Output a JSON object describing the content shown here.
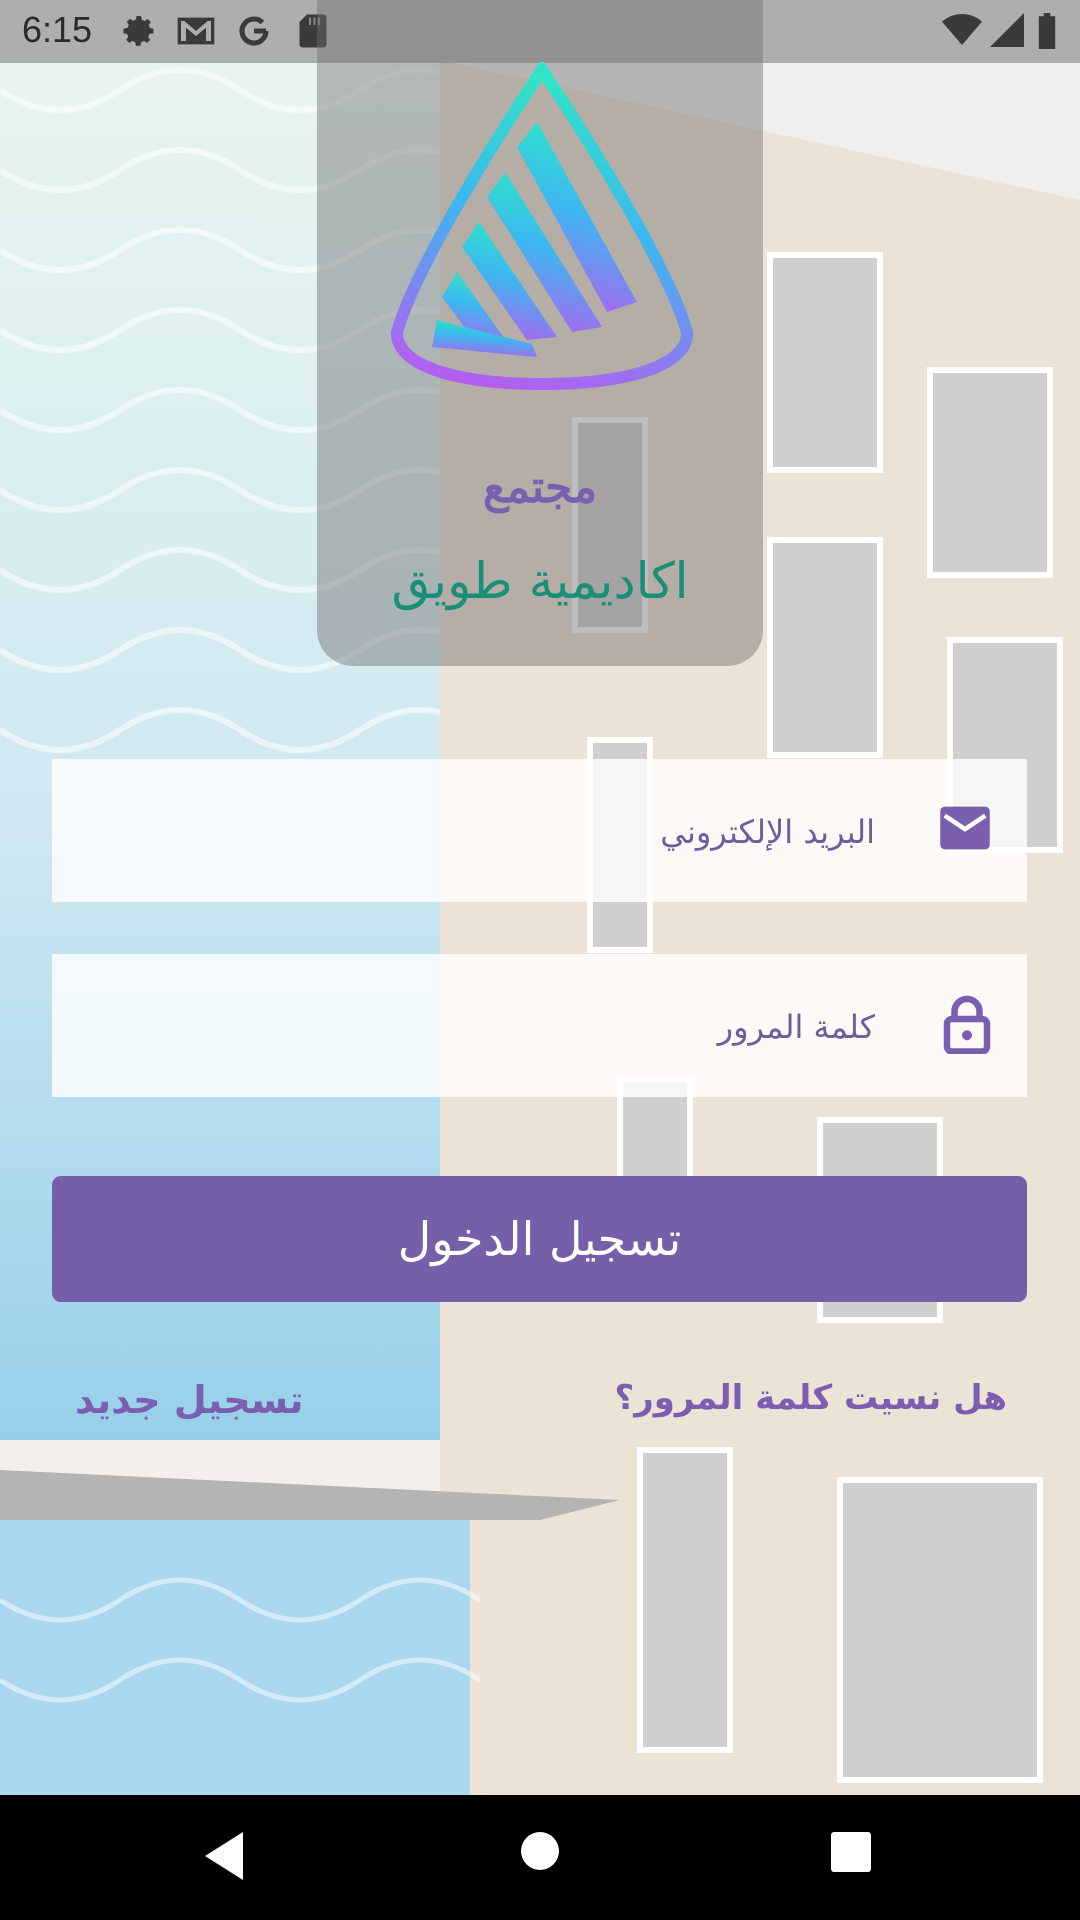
{
  "status_bar": {
    "time": "6:15",
    "left_icons": [
      "gear-icon",
      "gmail-icon",
      "google-icon",
      "sd-card-icon"
    ],
    "right_icons": [
      "wifi-icon",
      "signal-icon",
      "battery-icon"
    ]
  },
  "brand": {
    "line1": "مجتمع",
    "line2": "اكاديمية طويق",
    "emblem_icon": "tuwaiq-academy-logo"
  },
  "email_field": {
    "placeholder": "البريد الإلكتروني",
    "value": "",
    "icon": "mail-icon"
  },
  "password_field": {
    "placeholder": "كلمة المرور",
    "value": "",
    "icon": "lock-icon"
  },
  "login_button": {
    "label": "تسجيل الدخول"
  },
  "links": {
    "forgot_password": "هل نسيت كلمة المرور؟",
    "register": "تسجيل جديد"
  },
  "nav_bar": {
    "buttons": [
      "back-icon",
      "home-icon",
      "recents-icon"
    ]
  },
  "colors": {
    "accent_purple": "#765ea8",
    "brand_teal": "#1a8f78",
    "link_purple": "#7a5fb0"
  }
}
